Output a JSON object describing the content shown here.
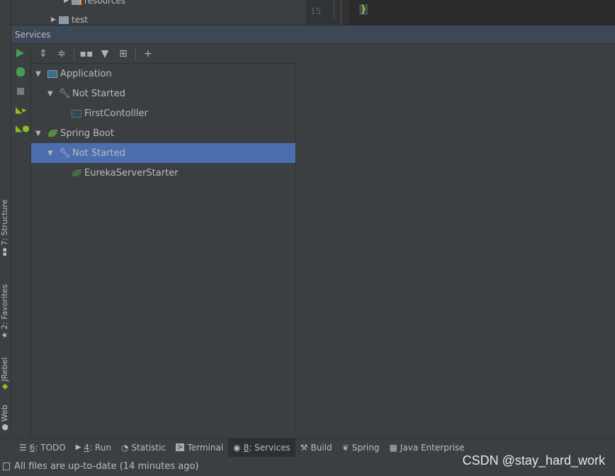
{
  "project_tree": {
    "items": [
      {
        "label": "resources"
      },
      {
        "label": "test"
      }
    ]
  },
  "editor": {
    "line_number": "15",
    "code": "}"
  },
  "services": {
    "title": "Services",
    "toolbar": [
      "expand-all-icon",
      "collapse-all-icon",
      "group-by-icon",
      "filter-icon",
      "new-tab-icon",
      "add-service-icon"
    ],
    "actions": [
      "run-icon",
      "debug-icon",
      "stop-icon",
      "jrebel-run-icon",
      "jrebel-debug-icon"
    ],
    "tree": [
      {
        "label": "Application",
        "level": 0,
        "icon": "application-icon",
        "expanded": true
      },
      {
        "label": "Not Started",
        "level": 1,
        "icon": "wrench-icon",
        "expanded": true
      },
      {
        "label": "FirstContolller",
        "level": 2,
        "icon": "application-icon"
      },
      {
        "label": "Spring Boot",
        "level": 0,
        "icon": "spring-boot-icon",
        "expanded": true
      },
      {
        "label": "Not Started",
        "level": 1,
        "icon": "wrench-icon",
        "expanded": true,
        "selected": true
      },
      {
        "label": "EurekaServerStarter",
        "level": 2,
        "icon": "spring-boot-icon"
      }
    ]
  },
  "left_tabs": [
    {
      "label": "7: Structure"
    },
    {
      "label": "2: Favorites"
    },
    {
      "label": "JRebel"
    },
    {
      "label": "Web"
    }
  ],
  "bottom_tabs": [
    {
      "key": "6",
      "label": ": TODO"
    },
    {
      "key": "4",
      "label": ": Run"
    },
    {
      "key": "",
      "label": "Statistic"
    },
    {
      "key": "",
      "label": "Terminal"
    },
    {
      "key": "8",
      "label": ": Services",
      "active": true
    },
    {
      "key": "",
      "label": "Build"
    },
    {
      "key": "",
      "label": "Spring"
    },
    {
      "key": "",
      "label": "Java Enterprise"
    }
  ],
  "status": {
    "text": "All files are up-to-date (14 minutes ago)"
  },
  "watermark": "CSDN @stay_hard_work",
  "colors": {
    "selection": "#4b6eaf",
    "header": "#3d4856",
    "run": "#499c54",
    "background": "#3c3f41"
  }
}
